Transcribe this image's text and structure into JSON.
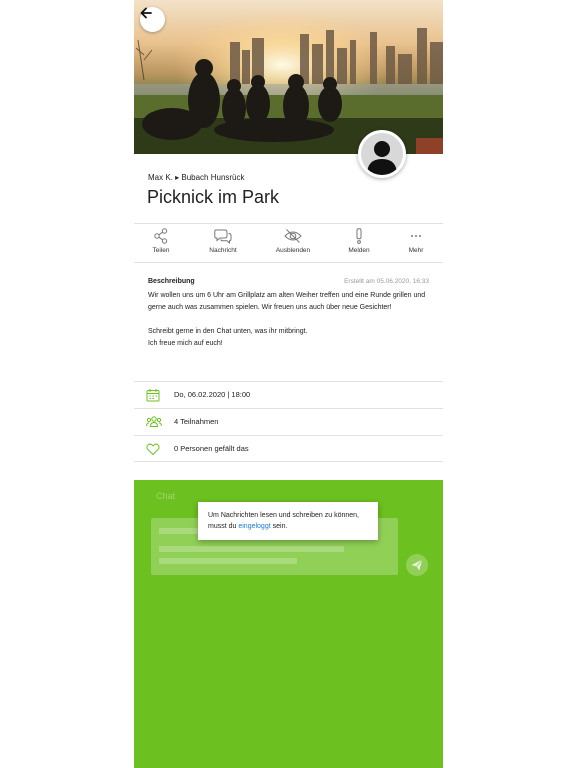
{
  "event": {
    "breadcrumb": "Max K. ▸ Bubach Hunsrück",
    "title": "Picknick im Park"
  },
  "actions": [
    {
      "label": "Teilen",
      "icon": "share-icon"
    },
    {
      "label": "Nachricht",
      "icon": "chat-bubbles-icon"
    },
    {
      "label": "Ausblenden",
      "icon": "eye-off-icon"
    },
    {
      "label": "Melden",
      "icon": "exclamation-icon"
    },
    {
      "label": "Mehr",
      "icon": "more-dots-icon"
    }
  ],
  "description": {
    "heading": "Beschreibung",
    "created": "Erstellt am 05.06.2020, 16:33",
    "paragraph1": "Wir wollen uns um 6 Uhr am Grillplatz am alten Weiher treffen und eine Runde grillen und gerne auch was zusammen spielen. Wir freuen uns auch über neue Gesichter!",
    "paragraph2_line1": "Schreibt gerne in den Chat unten, was ihr mitbringt.",
    "paragraph2_line2": "Ich freue mich auf euch!"
  },
  "details": {
    "date": "Do, 06.02.2020 | 18:00",
    "participants": "4 Teilnahmen",
    "likes": "0 Personen gefällt das"
  },
  "chat": {
    "label": "Chat",
    "login_prefix": "Um Nachrichten lesen und schreiben zu können, musst du",
    "login_link": "eingeloggt",
    "login_suffix": "sein."
  },
  "colors": {
    "accent_green": "#6cc01f",
    "icon_green": "#6cc01f",
    "link_blue": "#1a7bd6"
  }
}
